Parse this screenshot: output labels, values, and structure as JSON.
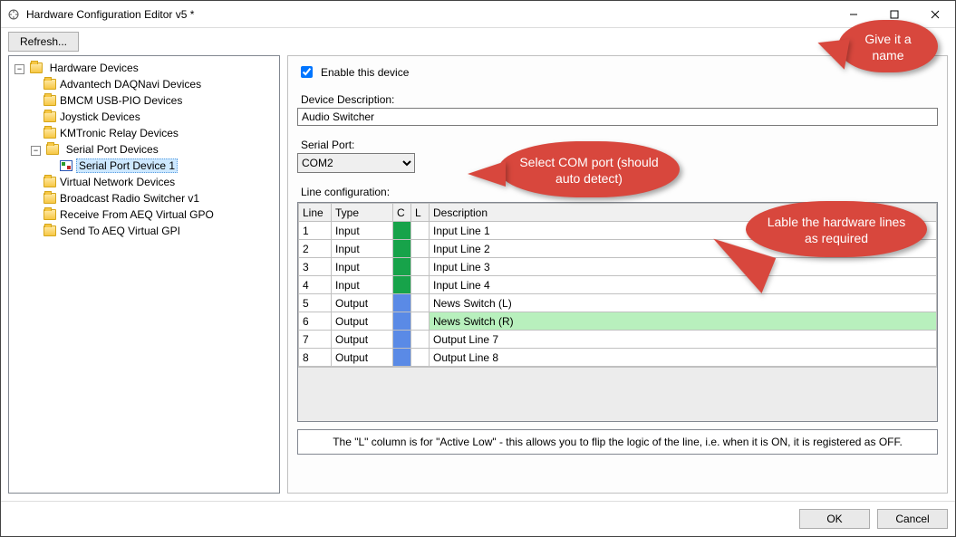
{
  "window": {
    "title": "Hardware Configuration Editor v5 *"
  },
  "toolbar": {
    "refresh_label": "Refresh..."
  },
  "tree": {
    "root_label": "Hardware Devices",
    "items": [
      {
        "label": "Advantech DAQNavi Devices"
      },
      {
        "label": "BMCM USB-PIO Devices"
      },
      {
        "label": "Joystick Devices"
      },
      {
        "label": "KMTronic Relay Devices"
      },
      {
        "label": "Serial Port Devices",
        "children": [
          {
            "label": "Serial Port Device 1",
            "selected": true
          }
        ]
      },
      {
        "label": "Virtual Network Devices"
      },
      {
        "label": "Broadcast Radio Switcher v1"
      },
      {
        "label": "Receive From AEQ Virtual GPO"
      },
      {
        "label": "Send To AEQ Virtual GPI"
      }
    ]
  },
  "panel": {
    "enable_label": "Enable this device",
    "enable_checked": true,
    "desc_label": "Device Description:",
    "desc_value": "Audio Switcher",
    "serial_label": "Serial Port:",
    "serial_value": "COM2",
    "grid_label": "Line configuration:",
    "headers": {
      "line": "Line",
      "type": "Type",
      "c": "C",
      "l": "L",
      "desc": "Description"
    },
    "rows": [
      {
        "line": "1",
        "type": "Input",
        "c": "green",
        "desc": "Input Line 1"
      },
      {
        "line": "2",
        "type": "Input",
        "c": "green",
        "desc": "Input Line 2"
      },
      {
        "line": "3",
        "type": "Input",
        "c": "green",
        "desc": "Input Line 3"
      },
      {
        "line": "4",
        "type": "Input",
        "c": "green",
        "desc": "Input Line 4"
      },
      {
        "line": "5",
        "type": "Output",
        "c": "blue",
        "desc": "News Switch (L)"
      },
      {
        "line": "6",
        "type": "Output",
        "c": "blue",
        "desc": "News Switch (R)",
        "selected": true
      },
      {
        "line": "7",
        "type": "Output",
        "c": "blue",
        "desc": "Output Line 7"
      },
      {
        "line": "8",
        "type": "Output",
        "c": "blue",
        "desc": "Output Line 8"
      }
    ],
    "hint": "The \"L\" column is for \"Active Low\" - this allows you to flip the logic of the line, i.e. when it is ON, it is registered as OFF."
  },
  "buttons": {
    "ok": "OK",
    "cancel": "Cancel"
  },
  "callouts": {
    "name": "Give it a name",
    "port": "Select COM port (should auto detect)",
    "lines": "Lable the hardware lines as required"
  }
}
